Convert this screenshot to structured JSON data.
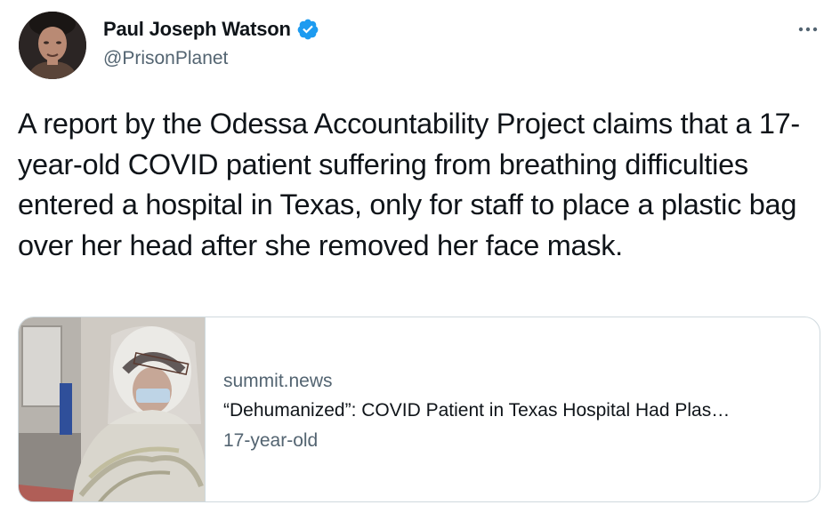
{
  "tweet": {
    "author": {
      "name": "Paul Joseph Watson",
      "handle": "@PrisonPlanet",
      "avatar_icon": "profile-photo",
      "verified": true,
      "verified_color": "#1d9bf0"
    },
    "more_icon": "more-horizontal-icon",
    "text": "A report by the Odessa Accountability Project claims that a 17-year-old COVID patient suffering from breathing difficulties entered a hospital in Texas, only for staff to place a plastic bag over her head after she removed her face mask.",
    "link_card": {
      "domain": "summit.news",
      "title": "“Dehumanized”: COVID Patient in Texas Hospital Had Plas…",
      "description": "17-year-old",
      "thumbnail_icon": "article-thumbnail-photo"
    }
  },
  "colors": {
    "text_primary": "#0f1419",
    "text_secondary": "#536471",
    "border": "#cfd9de",
    "accent": "#1d9bf0"
  }
}
